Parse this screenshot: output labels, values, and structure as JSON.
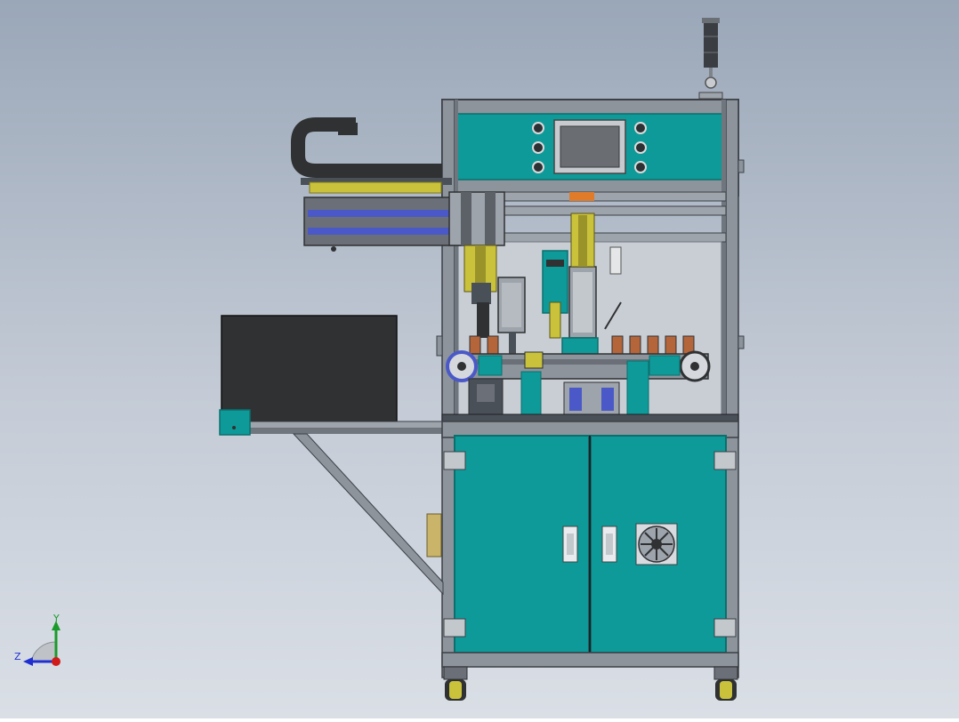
{
  "viewport": {
    "background_top": "#9aa7b8",
    "background_bottom": "#dadfe6"
  },
  "colors": {
    "teal": "#0e9a98",
    "teal_dark": "#0b6f6e",
    "frame": "#8d949c",
    "frame_dark": "#4a5058",
    "dark_panel": "#2f3133",
    "yellow": "#c9c23a",
    "blue_stripe": "#4a59c7",
    "copper": "#b5653a"
  },
  "triad": {
    "y_label": "Y",
    "z_label": "Z",
    "y_color": "#1a9a2a",
    "z_color": "#1f2fd0",
    "origin_color": "#d11b1b"
  },
  "icons": [
    "signal-tower-icon",
    "touch-screen-icon",
    "cooling-fan-icon",
    "caster-wheel-icon",
    "door-handle-icon",
    "view-triad-icon"
  ]
}
